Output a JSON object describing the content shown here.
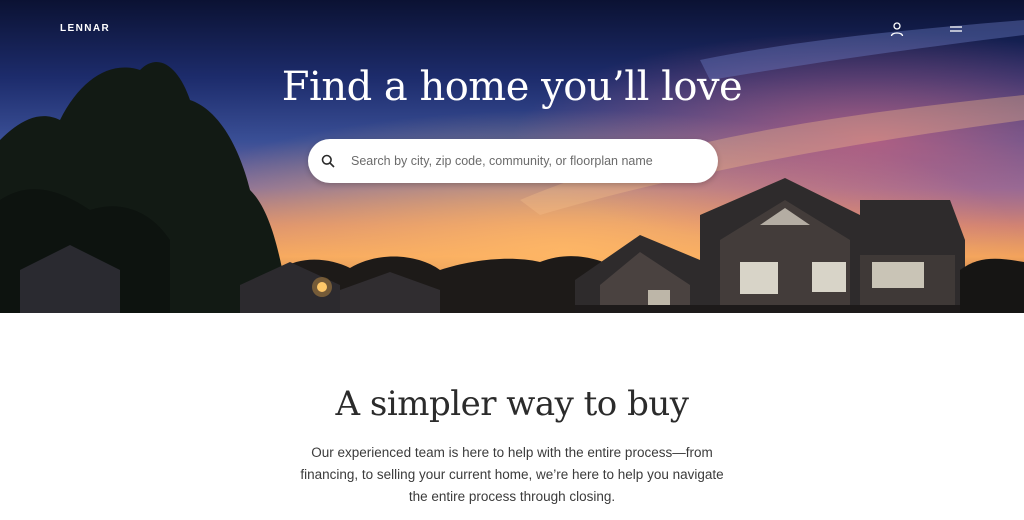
{
  "header": {
    "logo": "LENNAR",
    "account_icon": "user-icon",
    "menu_icon": "hamburger-menu-icon"
  },
  "hero": {
    "title": "Find a home you’ll love",
    "search": {
      "placeholder": "Search by city, zip code, community, or floorplan name",
      "value": "",
      "icon": "search-icon"
    }
  },
  "intro": {
    "title": "A simpler way to buy",
    "body": "Our experienced team is here to help with the entire process—from financing, to selling your current home, we’re here to help you navigate the entire process through closing."
  },
  "colors": {
    "hero_text": "#ffffff",
    "body_text": "#3b3b3b",
    "heading_text": "#2b2b2b"
  }
}
